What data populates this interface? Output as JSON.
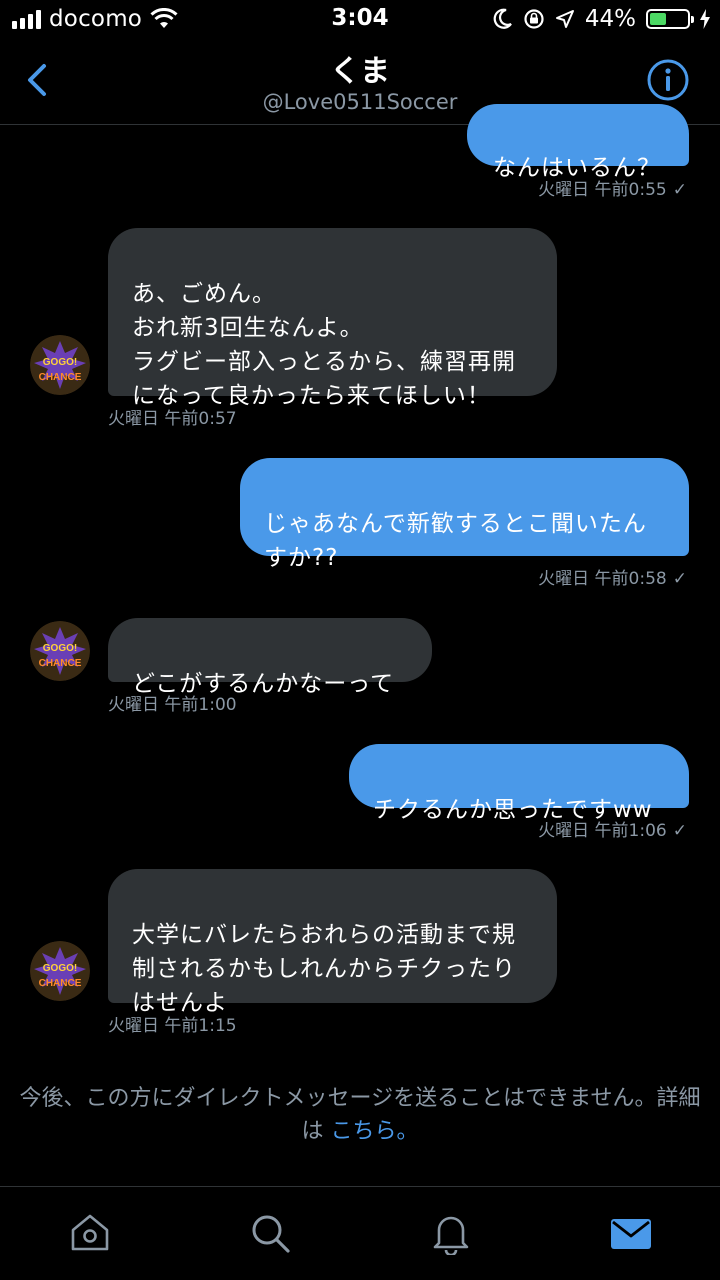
{
  "status_bar": {
    "carrier": "docomo",
    "time": "3:04",
    "battery_percent": "44%",
    "battery_level": 0.44,
    "icons": [
      "signal-icon",
      "wifi-icon",
      "moon-icon",
      "rotation-lock-icon",
      "location-icon",
      "battery-icon",
      "charging-icon"
    ]
  },
  "header": {
    "title": "くま",
    "handle": "@Love0511Soccer",
    "back_icon": "chevron-left-icon",
    "info_icon": "info-icon"
  },
  "messages": [
    {
      "direction": "sent",
      "text": "なんはいるん？",
      "time": "火曜日 午前0:55",
      "read": "✓"
    },
    {
      "direction": "received",
      "text": "あ、ごめん。\nおれ新3回生なんよ。\nラグビー部入っとるから、練習再開\nになって良かったら来てほしい！",
      "time": "火曜日 午前0:57"
    },
    {
      "direction": "sent",
      "text": "じゃあなんで新歓するとこ聞いたん\nすか??",
      "time": "火曜日 午前0:58",
      "read": "✓"
    },
    {
      "direction": "received",
      "text": "どこがするんかなーって",
      "time": "火曜日 午前1:00"
    },
    {
      "direction": "sent",
      "text": "チクるんか思ったですww",
      "time": "火曜日 午前1:06",
      "read": "✓"
    },
    {
      "direction": "received",
      "text": "大学にバレたらおれらの活動まで規\n制されるかもしれんからチクったり\nはせんよ",
      "time": "火曜日 午前1:15"
    }
  ],
  "avatar": {
    "text_top": "GOGO!",
    "text_bottom": "CHANCE"
  },
  "notice": {
    "text": "今後、この方にダイレクトメッセージを送ることはできません。詳細は",
    "link": "こちら。"
  },
  "tab_bar": {
    "tabs": [
      "home-icon",
      "search-icon",
      "notifications-icon",
      "messages-icon"
    ],
    "active": "messages-icon",
    "accent": "#4a99e9"
  },
  "colors": {
    "background": "#000000",
    "sent_bubble": "#4a99e9",
    "received_bubble": "#2f3336",
    "meta_text": "#8b98a5",
    "accent": "#4a99e9"
  }
}
